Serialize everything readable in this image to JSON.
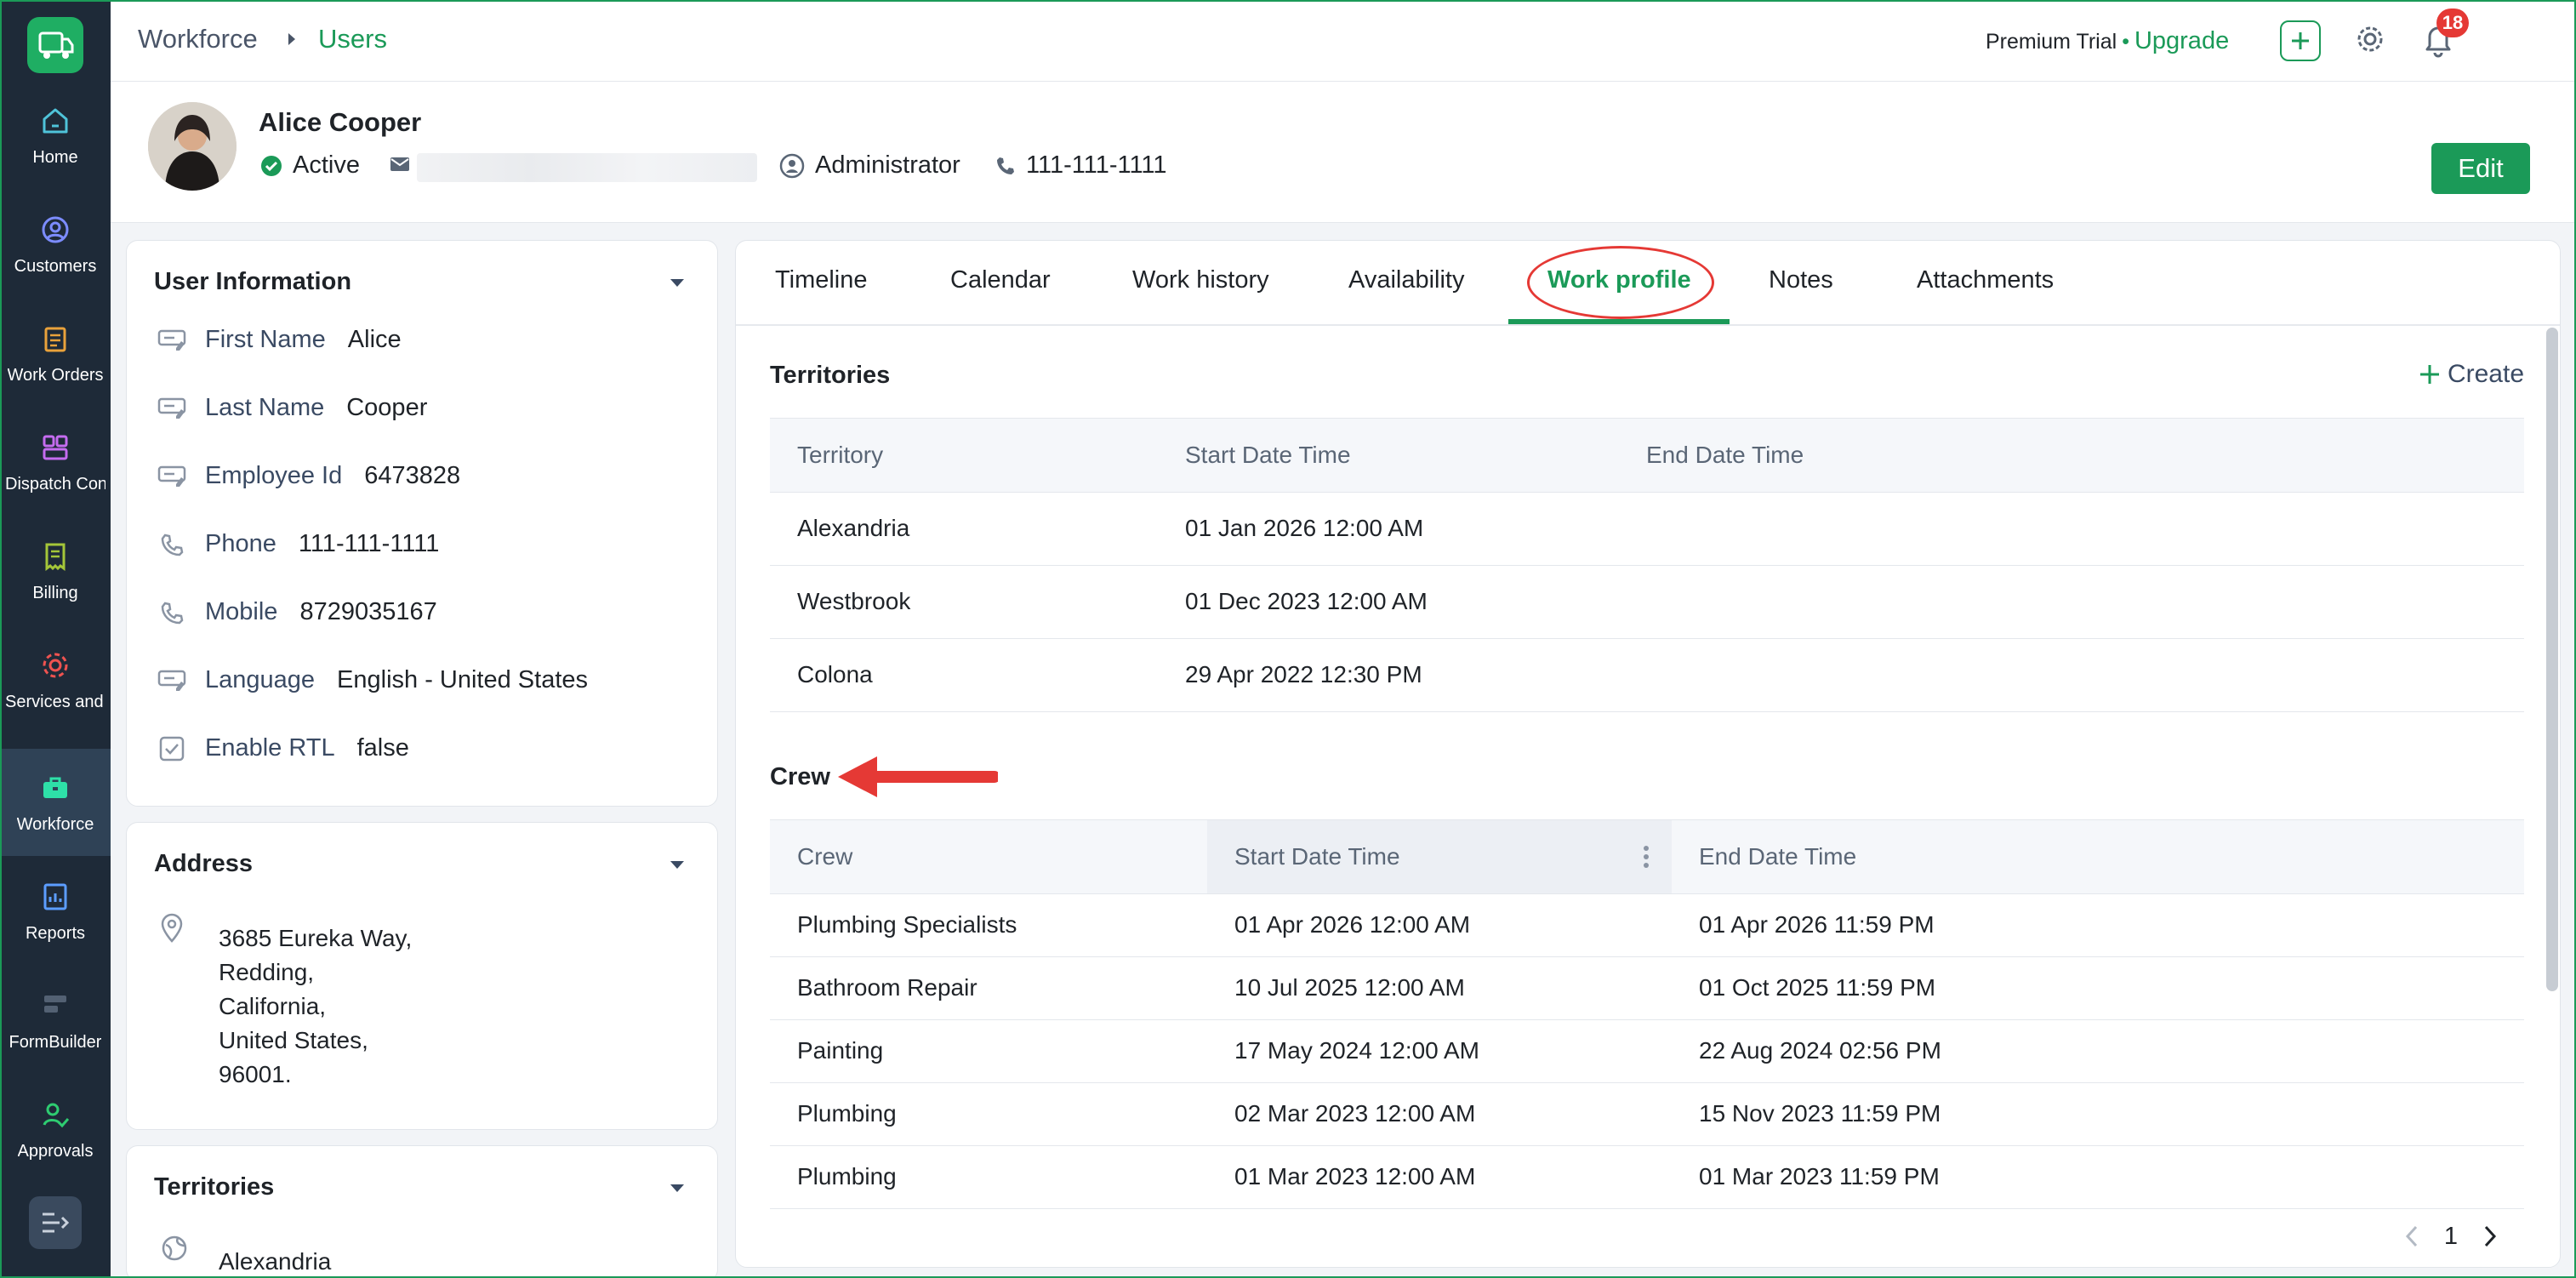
{
  "nav": {
    "items": [
      {
        "label": "Home",
        "icon": "home-icon"
      },
      {
        "label": "Customers",
        "icon": "customers-icon"
      },
      {
        "label": "Work Orders",
        "icon": "clipboard-icon"
      },
      {
        "label": "Dispatch Console",
        "icon": "dispatch-icon"
      },
      {
        "label": "Billing",
        "icon": "billing-icon"
      },
      {
        "label": "Services and Parts",
        "icon": "services-icon"
      },
      {
        "label": "Workforce",
        "icon": "briefcase-icon"
      },
      {
        "label": "Reports",
        "icon": "reports-icon"
      },
      {
        "label": "FormBuilder",
        "icon": "formbuilder-icon"
      },
      {
        "label": "Approvals",
        "icon": "approval-icon"
      }
    ],
    "active": "Workforce"
  },
  "topbar": {
    "breadcrumb": [
      "Workforce",
      "Users"
    ],
    "trial_label": "Premium Trial",
    "separator": "•",
    "upgrade_label": "Upgrade",
    "notification_count": "18"
  },
  "user": {
    "name": "Alice Cooper",
    "status": "Active",
    "role": "Administrator",
    "phone": "111-111-1111",
    "edit_label": "Edit"
  },
  "user_info": {
    "title": "User Information",
    "fields": [
      {
        "label": "First Name",
        "value": "Alice"
      },
      {
        "label": "Last Name",
        "value": "Cooper"
      },
      {
        "label": "Employee Id",
        "value": "6473828"
      },
      {
        "label": "Phone",
        "value": "111-111-1111"
      },
      {
        "label": "Mobile",
        "value": "8729035167"
      },
      {
        "label": "Language",
        "value": "English - United States"
      },
      {
        "label": "Enable RTL",
        "value": "false"
      }
    ]
  },
  "address": {
    "title": "Address",
    "lines": [
      "3685 Eureka Way,",
      "Redding,",
      "California,",
      "United States,",
      "96001."
    ]
  },
  "territories_card": {
    "title": "Territories",
    "first_item": "Alexandria"
  },
  "tabs": [
    "Timeline",
    "Calendar",
    "Work history",
    "Availability",
    "Work profile",
    "Notes",
    "Attachments"
  ],
  "active_tab": "Work profile",
  "territories": {
    "title": "Territories",
    "create_label": "Create",
    "columns": [
      "Territory",
      "Start Date Time",
      "End Date Time"
    ],
    "rows": [
      [
        "Alexandria",
        "01 Jan 2026 12:00 AM",
        ""
      ],
      [
        "Westbrook",
        "01 Dec 2023 12:00 AM",
        ""
      ],
      [
        "Colona",
        "29 Apr 2022 12:30 PM",
        ""
      ]
    ]
  },
  "crew": {
    "title": "Crew",
    "columns": [
      "Crew",
      "Start Date Time",
      "End Date Time"
    ],
    "rows": [
      [
        "Plumbing Specialists",
        "01 Apr 2026 12:00 AM",
        "01 Apr 2026 11:59 PM"
      ],
      [
        "Bathroom Repair",
        "10 Jul 2025 12:00 AM",
        "01 Oct 2025 11:59 PM"
      ],
      [
        "Painting",
        "17 May 2024 12:00 AM",
        "22 Aug 2024 02:56 PM"
      ],
      [
        "Plumbing",
        "02 Mar 2023 12:00 AM",
        "15 Nov 2023 11:59 PM"
      ],
      [
        "Plumbing",
        "01 Mar 2023 12:00 AM",
        "01 Mar 2023 11:59 PM"
      ]
    ]
  },
  "pagination": {
    "page": "1"
  },
  "colors": {
    "accent": "#1b9a58",
    "sidebar": "#1e2a38",
    "annotation": "#e53935"
  }
}
